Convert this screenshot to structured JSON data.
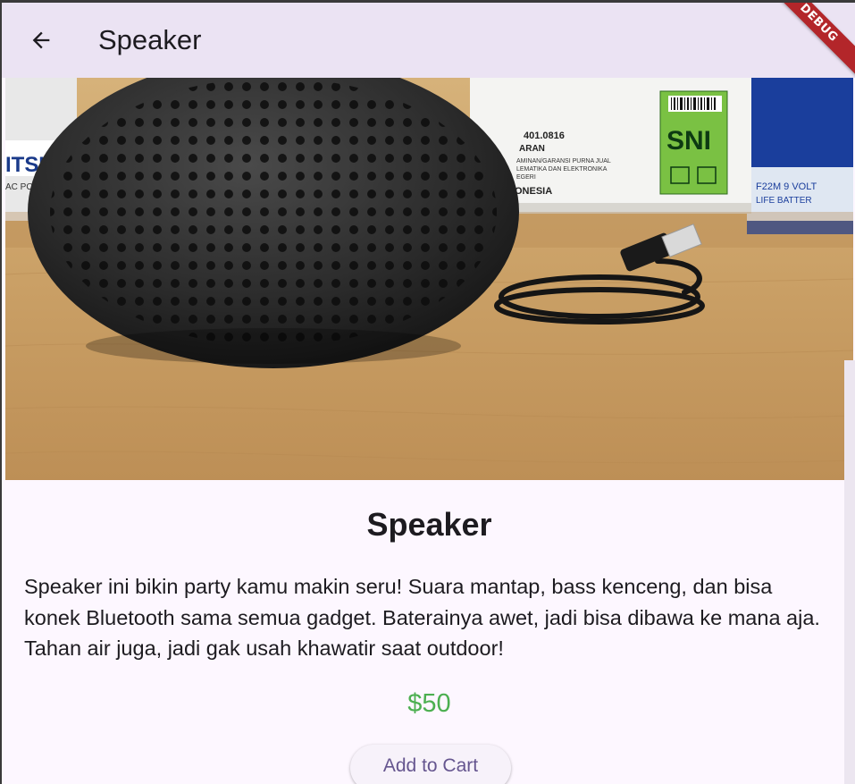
{
  "appbar": {
    "title": "Speaker",
    "back_icon": "arrow-back-icon",
    "debug_banner": "DEBUG"
  },
  "product": {
    "image_icon": "product-photo-speaker",
    "title": "Speaker",
    "description": "Speaker ini bikin party kamu makin seru! Suara mantap, bass kenceng, dan bisa konek Bluetooth sama semua gadget. Baterainya awet, jadi bisa dibawa ke mana aja. Tahan air juga, jadi gak usah khawatir saat outdoor!",
    "price": "$50",
    "add_to_cart_label": "Add to Cart"
  },
  "image_text": {
    "box_code": "401.0816",
    "box_line1": "ARAN",
    "box_line2": "AMINAN/GARANSI PURNA JUAL",
    "box_line3": "LEMATIKA DAN ELEKTRONIKA",
    "box_line4": "EGERI",
    "box_line5": "ONESIA",
    "sni_label": "SNI",
    "left_box_text": "ITSU",
    "left_box_sub": "AC POWE",
    "right_box_text1": "F22M  9 VOLT",
    "right_box_text2": "LIFE BATTER"
  },
  "colors": {
    "appbar_bg": "#ebe3f3",
    "body_bg": "#fdf7ff",
    "price": "#4caf50",
    "button_text": "#65558f",
    "debug_ribbon": "#b3262a"
  }
}
